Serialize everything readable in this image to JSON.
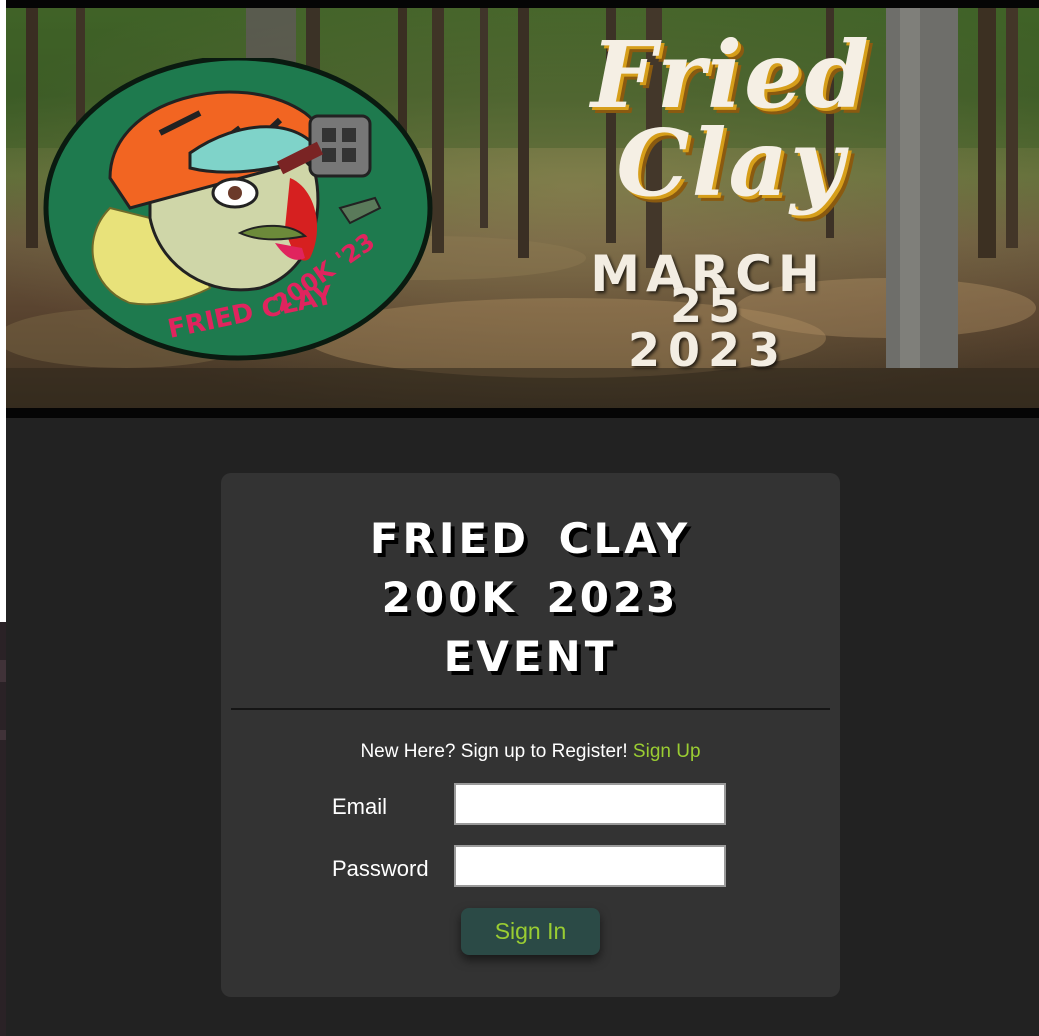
{
  "banner": {
    "title_line1": "Fried",
    "title_line2": "Clay",
    "date_month": "MARCH",
    "date_day": "25",
    "date_year": "2023",
    "logo": {
      "text_top": "200K '23",
      "text_bottom": "FRIED CLAY",
      "colors": {
        "badge_green": "#1e7a4e",
        "helmet_orange": "#f26522",
        "text_red": "#e0245e"
      }
    }
  },
  "card": {
    "title_lines": [
      "FRIED CLAY",
      "200K 2023",
      "EVENT"
    ],
    "signup_prompt": "New Here? Sign up to Register!",
    "signup_link": "Sign Up",
    "email_label": "Email",
    "email_value": "",
    "password_label": "Password",
    "password_value": "",
    "signin_label": "Sign In"
  },
  "colors": {
    "page_background": "#222222",
    "card_background": "#333333",
    "accent_green": "#9acd32",
    "button_background": "#2b4a46"
  }
}
